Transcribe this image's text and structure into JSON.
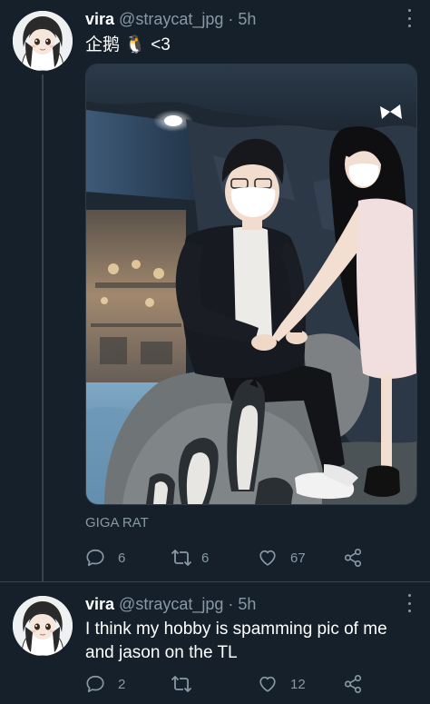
{
  "tweets": [
    {
      "name": "vira",
      "handle": "@straycat_jpg",
      "separator": "·",
      "time": "5h",
      "text": "企鹅 🐧 <3",
      "media_caption": "GIGA RAT",
      "icons": {
        "reply": "reply-icon",
        "retweet": "retweet-icon",
        "like": "heart-icon",
        "share": "share-icon",
        "more": "more-icon"
      },
      "counts": {
        "reply": "6",
        "retweet": "6",
        "like": "67"
      }
    },
    {
      "name": "vira",
      "handle": "@straycat_jpg",
      "separator": "·",
      "time": "5h",
      "text": "I think my hobby is spamming pic of me and jason on the TL",
      "icons": {
        "reply": "reply-icon",
        "retweet": "retweet-icon",
        "like": "heart-icon",
        "share": "share-icon",
        "more": "more-icon"
      },
      "counts": {
        "reply": "2",
        "retweet": "",
        "like": "12"
      }
    }
  ],
  "colors": {
    "background": "#15202b",
    "secondary_text": "#8899a6",
    "divider": "#38444d"
  }
}
